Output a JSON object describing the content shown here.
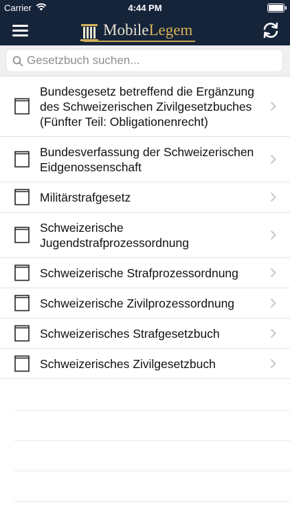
{
  "status": {
    "carrier": "Carrier",
    "time": "4:44 PM"
  },
  "nav": {
    "logo_part1": "Mobile",
    "logo_part2": "Legem"
  },
  "search": {
    "placeholder": "Gesetzbuch suchen..."
  },
  "items": [
    {
      "label": "Bundesgesetz betreffend die Ergänzung des Schweizerischen Zivilgesetzbuches (Fünfter Teil: Obligationenrecht)"
    },
    {
      "label": "Bundesverfassung der Schweizerischen Eidgenossenschaft"
    },
    {
      "label": "Militärstrafgesetz"
    },
    {
      "label": "Schweizerische Jugendstrafprozessordnung"
    },
    {
      "label": "Schweizerische Strafprozessordnung"
    },
    {
      "label": "Schweizerische Zivilprozessordnung"
    },
    {
      "label": "Schweizerisches Strafgesetzbuch"
    },
    {
      "label": "Schweizerisches Zivilgesetzbuch"
    }
  ],
  "colors": {
    "nav_bg": "#16243a",
    "logo_gold": "#d6b35a"
  }
}
